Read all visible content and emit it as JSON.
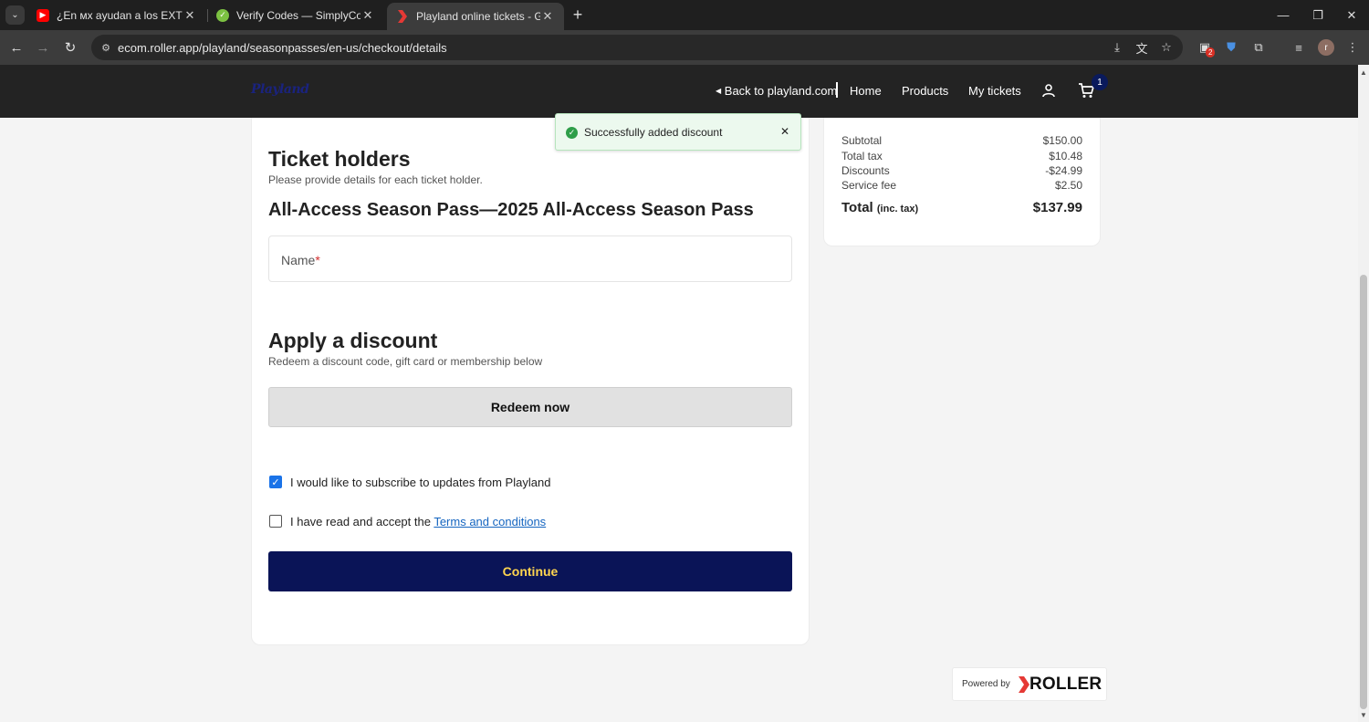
{
  "browser": {
    "tabs": [
      {
        "title": "¿En ᴍx ayudan a los EXTRANJEROS",
        "close": "✕"
      },
      {
        "title": "Verify Codes — SimplyCodes",
        "close": "✕"
      },
      {
        "title": "Playland online tickets - Guest checkout",
        "close": "✕"
      }
    ],
    "new_tab": "+",
    "url": "ecom.roller.app/playland/seasonpasses/en-us/checkout/details",
    "extension_badge": "2",
    "profile_initial": "r"
  },
  "header": {
    "logo": "Playland",
    "back_link": "Back to playland.com",
    "nav": [
      "Home",
      "Products",
      "My tickets"
    ],
    "cart_count": "1"
  },
  "toast": {
    "message": "Successfully added discount"
  },
  "ticket_holders": {
    "title": "Ticket holders",
    "subtitle": "Please provide details for each ticket holder.",
    "product": "All-Access Season Pass—2025 All-Access Season Pass",
    "name_label": "Name",
    "required_mark": "*"
  },
  "discount": {
    "title": "Apply a discount",
    "subtitle": "Redeem a discount code, gift card or membership below",
    "button": "Redeem now"
  },
  "consents": {
    "subscribe": {
      "label": "I would like to subscribe to updates from Playland",
      "checked": true
    },
    "terms": {
      "prefix": "I have read and accept the ",
      "link": "Terms and conditions",
      "checked": false
    }
  },
  "continue_button": "Continue",
  "summary": {
    "rows": [
      {
        "label": "Subtotal",
        "value": "$150.00"
      },
      {
        "label": "Total tax",
        "value": "$10.48"
      },
      {
        "label": "Discounts",
        "value": "-$24.99"
      },
      {
        "label": "Service fee",
        "value": "$2.50"
      }
    ],
    "total_label": "Total",
    "total_note": "(inc. tax)",
    "total_value": "$137.99"
  },
  "footer": {
    "powered_by": "Powered by",
    "brand": "ROLLER"
  },
  "colors": {
    "accent": "#0a1457",
    "continue_text": "#ffd54f",
    "success": "#2e9e49",
    "link": "#1565c0",
    "brand_red": "#e53935"
  }
}
